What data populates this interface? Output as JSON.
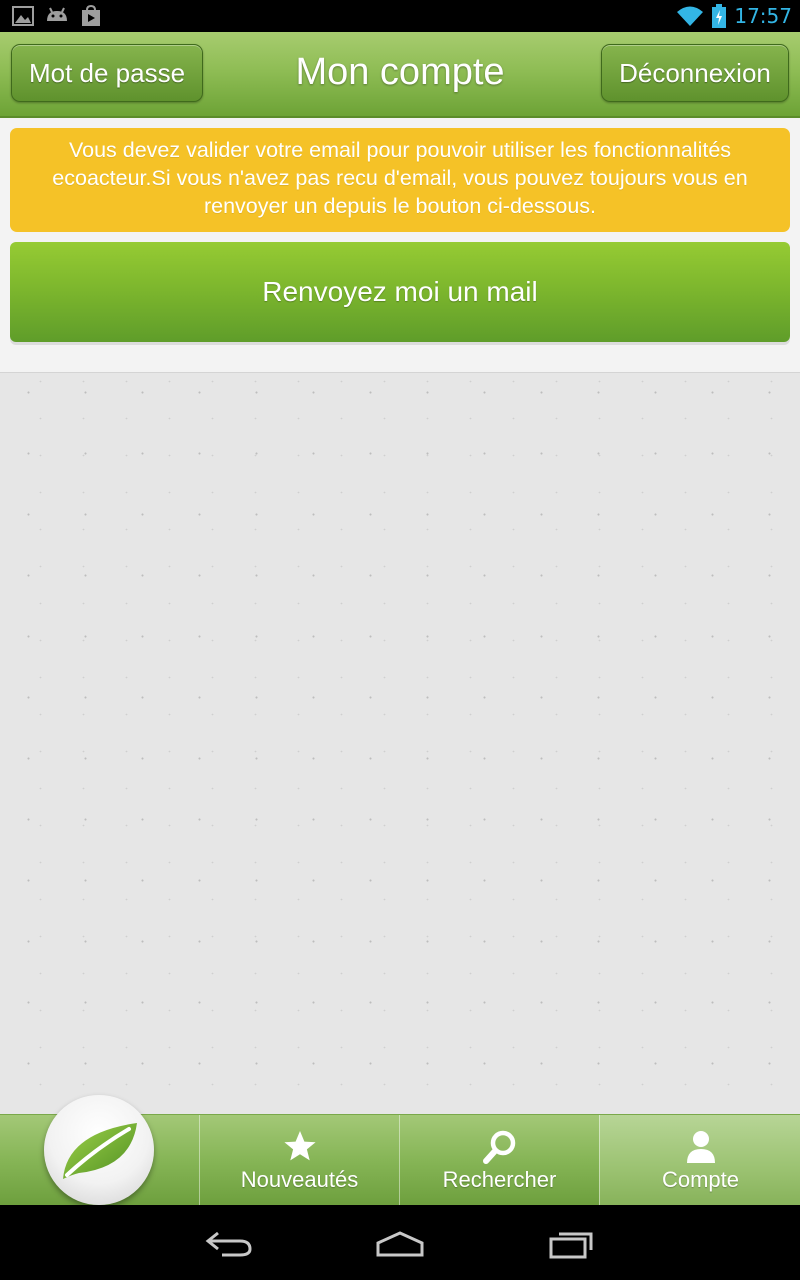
{
  "status_bar": {
    "time": "17:57",
    "accent_color": "#33b5e5",
    "icons": [
      "gallery-icon",
      "android-icon",
      "play-store-icon",
      "wifi-icon",
      "battery-charging-icon"
    ]
  },
  "header": {
    "title": "Mon compte",
    "left_button": "Mot de passe",
    "right_button": "Déconnexion"
  },
  "alert": {
    "message": "Vous devez valider votre email pour pouvoir utiliser les fonctionnalités ecoacteur.Si vous n'avez pas recu d'email, vous pouvez toujours vous en renvoyer un depuis le bouton ci-dessous.",
    "color": "#f5c227"
  },
  "resend_button": {
    "label": "Renvoyez moi un mail",
    "color": "#7bb52d"
  },
  "tabs": [
    {
      "label": "",
      "icon": "leaf-icon"
    },
    {
      "label": "Nouveautés",
      "icon": "star-icon"
    },
    {
      "label": "Rechercher",
      "icon": "search-icon"
    },
    {
      "label": "Compte",
      "icon": "user-icon",
      "selected": true
    }
  ],
  "nav_bar": {
    "icons": [
      "back-icon",
      "home-icon",
      "recent-apps-icon"
    ]
  }
}
